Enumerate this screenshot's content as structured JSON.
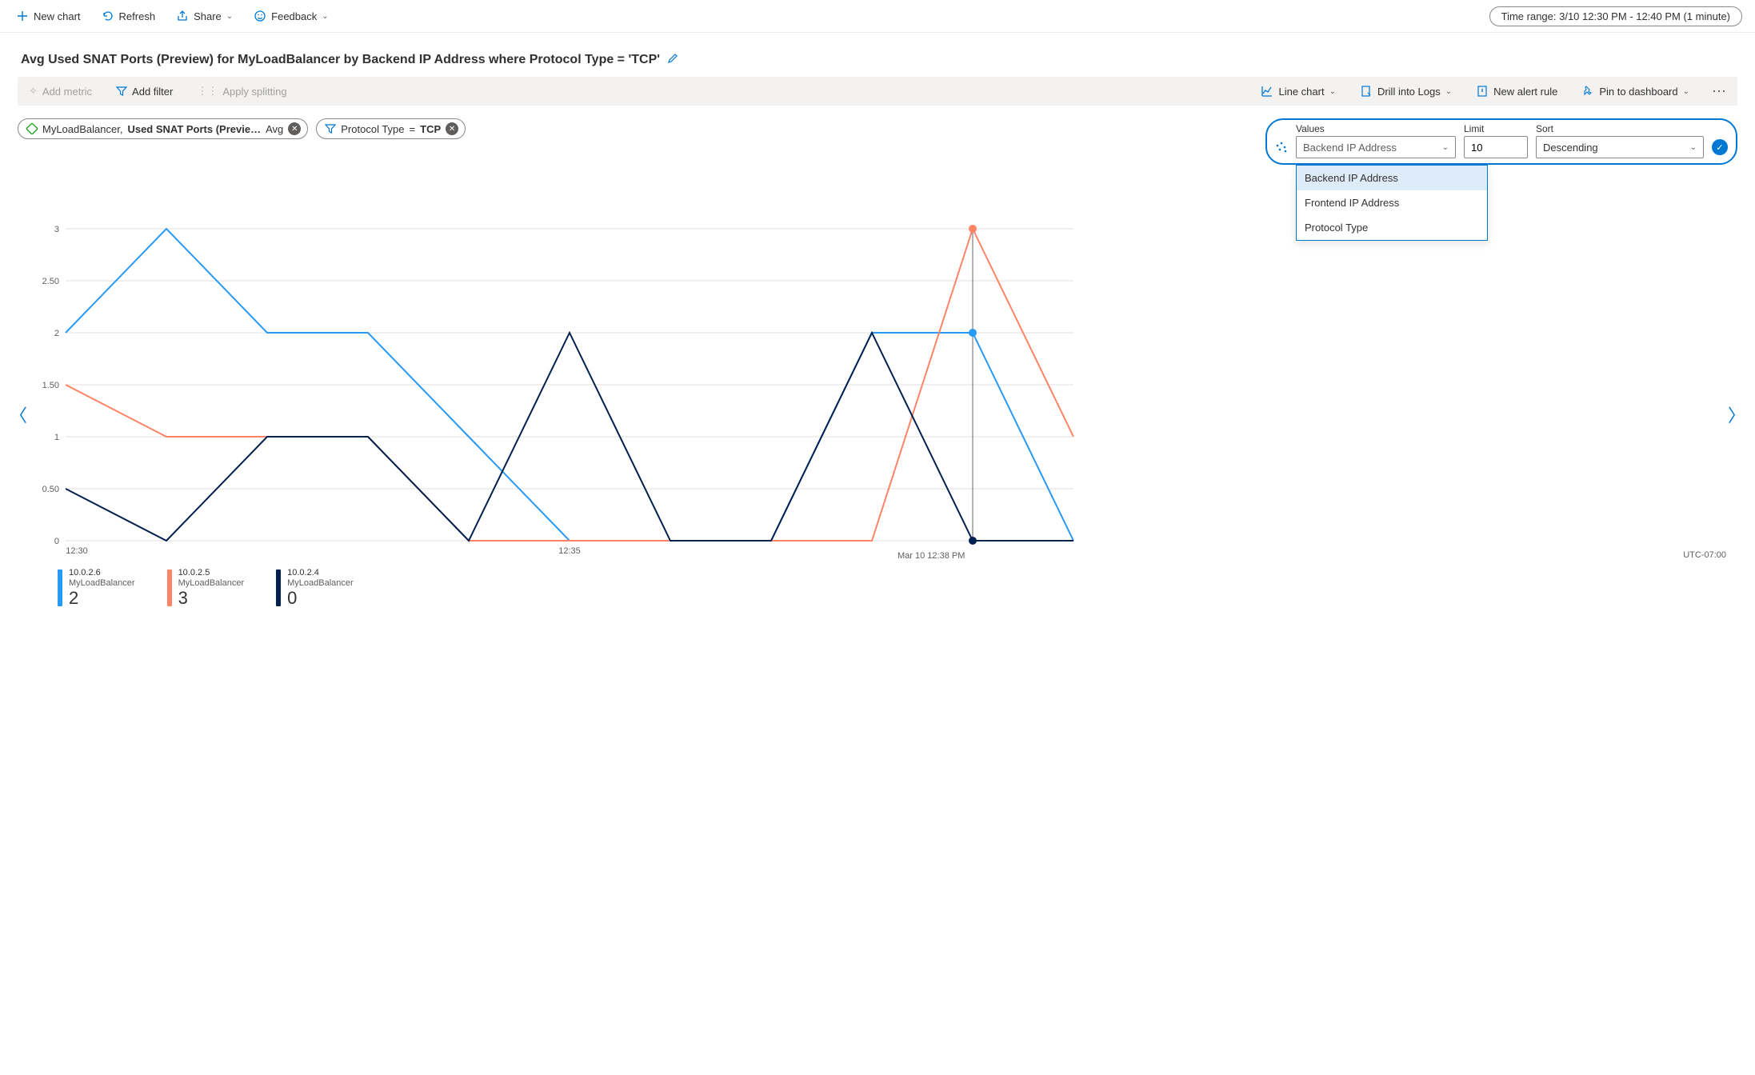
{
  "toolbar": {
    "new_chart": "New chart",
    "refresh": "Refresh",
    "share": "Share",
    "feedback": "Feedback",
    "time_range": "Time range: 3/10 12:30 PM - 12:40 PM (1 minute)"
  },
  "chart_header": {
    "title": "Avg Used SNAT Ports (Preview) for MyLoadBalancer by Backend IP Address where Protocol Type = 'TCP'"
  },
  "toolbar2": {
    "add_metric": "Add metric",
    "add_filter": "Add filter",
    "apply_splitting": "Apply splitting",
    "line_chart": "Line chart",
    "drill_logs": "Drill into Logs",
    "new_alert": "New alert rule",
    "pin_dashboard": "Pin to dashboard"
  },
  "pills": {
    "metric_resource": "MyLoadBalancer,",
    "metric_name": "Used SNAT Ports (Previe…",
    "metric_agg": "Avg",
    "filter_dim": "Protocol Type",
    "filter_op": "=",
    "filter_val": "TCP"
  },
  "split": {
    "values_label": "Values",
    "values_selected": "Backend IP Address",
    "values_options": [
      "Backend IP Address",
      "Frontend IP Address",
      "Protocol Type"
    ],
    "limit_label": "Limit",
    "limit_value": "10",
    "sort_label": "Sort",
    "sort_value": "Descending"
  },
  "chart_data": {
    "type": "line",
    "title": "Avg Used SNAT Ports (Preview) for MyLoadBalancer by Backend IP Address where Protocol Type = 'TCP'",
    "xlabel": "",
    "ylabel": "",
    "ylim": [
      0,
      3
    ],
    "y_ticks": [
      "0",
      "0.50",
      "1",
      "1.50",
      "2",
      "2.50",
      "3"
    ],
    "x_ticks": [
      "12:30",
      "12:35"
    ],
    "x": [
      0,
      1,
      2,
      3,
      4,
      5,
      6,
      7,
      8,
      9,
      10
    ],
    "series": [
      {
        "name": "10.0.2.6",
        "resource": "MyLoadBalancer",
        "color": "#2899f5",
        "values": [
          2,
          3,
          2,
          2,
          1,
          0,
          0,
          0,
          2,
          2,
          0
        ],
        "current": "2"
      },
      {
        "name": "10.0.2.5",
        "resource": "MyLoadBalancer",
        "color": "#ff8367",
        "values": [
          1.5,
          1,
          1,
          1,
          0,
          0,
          0,
          0,
          0,
          3,
          1
        ],
        "current": "3"
      },
      {
        "name": "10.0.2.4",
        "resource": "MyLoadBalancer",
        "color": "#002050",
        "values": [
          0.5,
          0,
          1,
          1,
          0,
          2,
          0,
          0,
          2,
          0,
          0
        ],
        "current": "0"
      }
    ],
    "cursor_index": 9,
    "timestamp_label": "Mar 10 12:38 PM",
    "timezone": "UTC-07:00"
  }
}
